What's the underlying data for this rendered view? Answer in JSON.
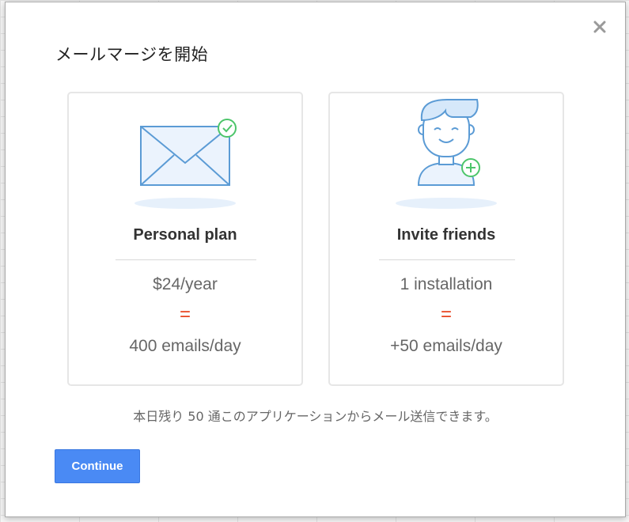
{
  "dialog": {
    "title": "メールマージを開始",
    "close_icon": "close-icon"
  },
  "cards": [
    {
      "icon": "envelope-check-icon",
      "title": "Personal plan",
      "line1": "$24/year",
      "equals": "=",
      "line3": "400 emails/day"
    },
    {
      "icon": "person-add-icon",
      "title": "Invite friends",
      "line1": "1 installation",
      "equals": "=",
      "line3": "+50 emails/day"
    }
  ],
  "note": "本日残り 50 通このアプリケーションからメール送信できます。",
  "buttons": {
    "continue_label": "Continue"
  },
  "colors": {
    "accent_blue": "#4a8af4",
    "equals_red": "#e8441f",
    "badge_green": "#4cc56a",
    "icon_blue": "#5b9bd5"
  }
}
